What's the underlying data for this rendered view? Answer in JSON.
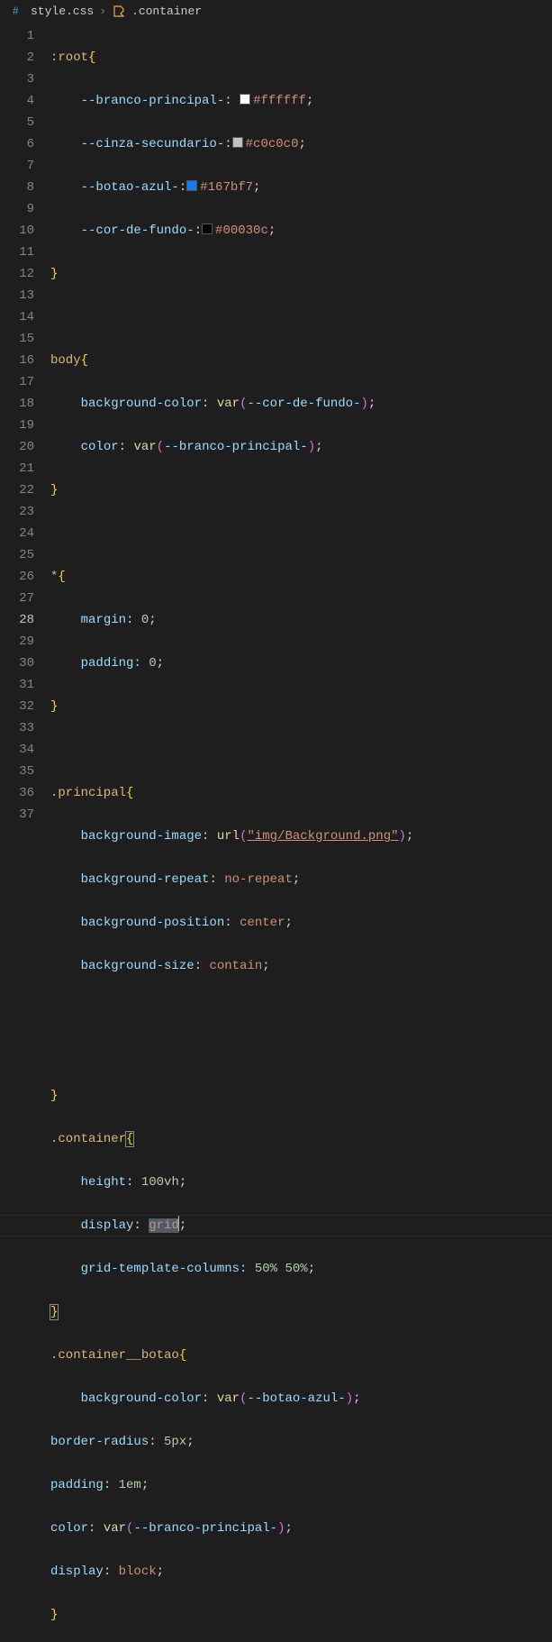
{
  "breadcrumb": {
    "file": "style.css",
    "symbol": ".container"
  },
  "activeLine": 28,
  "colors": {
    "branco": "#ffffff",
    "cinza": "#c0c0c0",
    "azul": "#167bf7",
    "fundo": "#00030c"
  },
  "code": {
    "l1_sel": ":root",
    "l2_prop": "--branco-principal-",
    "l2_val": "#ffffff",
    "l3_prop": "--cinza-secundario-",
    "l3_val": "#c0c0c0",
    "l4_prop": "--botao-azul-",
    "l4_val": "#167bf7",
    "l5_prop": "--cor-de-fundo-",
    "l5_val": "#00030c",
    "l8_sel": "body",
    "l9_prop": "background-color",
    "l9_fn": "var",
    "l9_arg": "--cor-de-fundo-",
    "l10_prop": "color",
    "l10_fn": "var",
    "l10_arg": "--branco-principal-",
    "l13_sel": "*",
    "l14_prop": "margin",
    "l14_val": "0",
    "l15_prop": "padding",
    "l15_val": "0",
    "l18_sel": ".principal",
    "l19_prop": "background-image",
    "l19_fn": "url",
    "l19_arg": "\"img/Background.png\"",
    "l20_prop": "background-repeat",
    "l20_val": "no-repeat",
    "l21_prop": "background-position",
    "l21_val": "center",
    "l22_prop": "background-size",
    "l22_val": "contain",
    "l26_sel": ".container",
    "l27_prop": "height",
    "l27_val": "100vh",
    "l28_prop": "display",
    "l28_val": "grid",
    "l29_prop": "grid-template-columns",
    "l29_val1": "50%",
    "l29_val2": "50%",
    "l31_sel": ".container__botao",
    "l32_prop": "background-color",
    "l32_fn": "var",
    "l32_arg": "--botao-azul-",
    "l33_prop": "border-radius",
    "l33_val": "5px",
    "l34_prop": "padding",
    "l34_val": "1em",
    "l35_prop": "color",
    "l35_fn": "var",
    "l35_arg": "--branco-principal-",
    "l36_prop": "display",
    "l36_val": "block"
  }
}
